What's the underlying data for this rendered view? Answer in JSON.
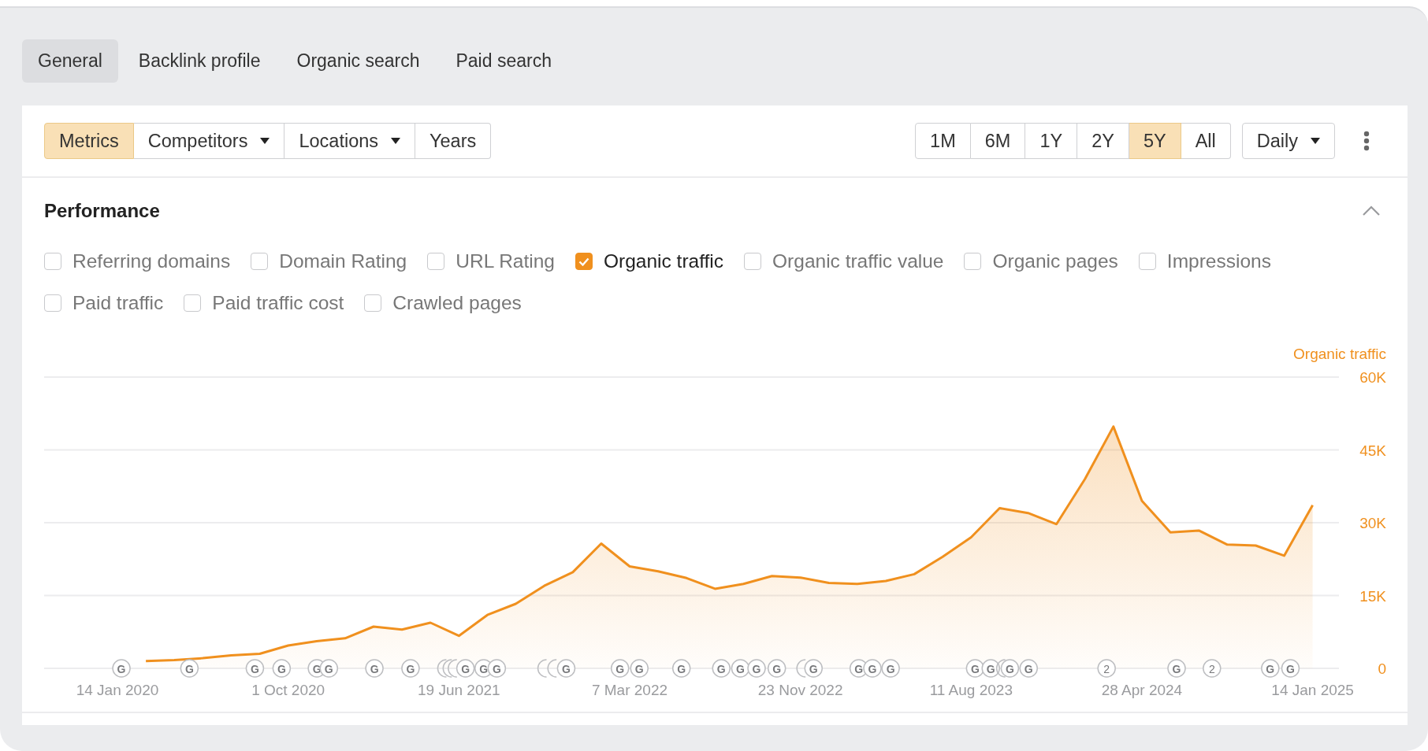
{
  "tabs": [
    {
      "label": "General",
      "selected": true
    },
    {
      "label": "Backlink profile",
      "selected": false
    },
    {
      "label": "Organic search",
      "selected": false
    },
    {
      "label": "Paid search",
      "selected": false
    }
  ],
  "toolbar": {
    "filters": [
      {
        "label": "Metrics",
        "selected": true,
        "kind": "toggle"
      },
      {
        "label": "Competitors",
        "selected": false,
        "kind": "dropdown"
      },
      {
        "label": "Locations",
        "selected": false,
        "kind": "dropdown"
      },
      {
        "label": "Years",
        "selected": false,
        "kind": "toggle"
      }
    ],
    "ranges": [
      {
        "label": "1M",
        "selected": false
      },
      {
        "label": "6M",
        "selected": false
      },
      {
        "label": "1Y",
        "selected": false
      },
      {
        "label": "2Y",
        "selected": false
      },
      {
        "label": "5Y",
        "selected": true
      },
      {
        "label": "All",
        "selected": false
      }
    ],
    "interval": {
      "label": "Daily"
    }
  },
  "performance": {
    "title": "Performance",
    "expanded": true,
    "metric_rows": [
      [
        {
          "label": "Referring domains",
          "checked": false
        },
        {
          "label": "Domain Rating",
          "checked": false
        },
        {
          "label": "URL Rating",
          "checked": false
        },
        {
          "label": "Organic traffic",
          "checked": true
        },
        {
          "label": "Organic traffic value",
          "checked": false
        },
        {
          "label": "Organic pages",
          "checked": false
        },
        {
          "label": "Impressions",
          "checked": false
        }
      ],
      [
        {
          "label": "Paid traffic",
          "checked": false
        },
        {
          "label": "Paid traffic cost",
          "checked": false
        },
        {
          "label": "Crawled pages",
          "checked": false
        }
      ]
    ],
    "chart_data": {
      "type": "area",
      "categories": [
        "14 Jan 2020",
        null,
        null,
        null,
        null,
        null,
        "1 Oct 2020",
        null,
        null,
        null,
        null,
        null,
        "19 Jun 2021",
        null,
        null,
        null,
        null,
        null,
        "7 Mar 2022",
        null,
        null,
        null,
        null,
        null,
        "23 Nov 2022",
        null,
        null,
        null,
        null,
        null,
        "11 Aug 2023",
        null,
        null,
        null,
        null,
        null,
        "28 Apr 2024",
        null,
        null,
        null,
        null,
        null,
        "14 Jan 2025"
      ],
      "series": [
        {
          "name": "Organic traffic",
          "color": "#f0901e",
          "values": [
            null,
            1500,
            1700,
            2100,
            2700,
            3000,
            4700,
            5600,
            6200,
            8600,
            8000,
            9400,
            6700,
            11000,
            13300,
            17000,
            19800,
            25700,
            21000,
            20000,
            18600,
            16400,
            17400,
            19000,
            18700,
            17600,
            17400,
            18000,
            19400,
            23000,
            27000,
            33000,
            32000,
            29700,
            39000,
            49800,
            34500,
            28000,
            28400,
            25500,
            25300,
            23200,
            33600
          ]
        }
      ],
      "ylim": [
        0,
        60000
      ],
      "grid": true,
      "yticks": [
        {
          "value": 0,
          "label": "0"
        },
        {
          "value": 15000,
          "label": "15K"
        },
        {
          "value": 30000,
          "label": "30K"
        },
        {
          "value": 45000,
          "label": "45K"
        },
        {
          "value": 60000,
          "label": "60K"
        }
      ]
    },
    "event_markers": [
      {
        "kind": "google",
        "text": "G"
      },
      {
        "kind": "google",
        "text": "G"
      },
      {
        "kind": "google",
        "text": "G"
      },
      {
        "kind": "google",
        "text": "G"
      },
      {
        "kind": "google",
        "text": "G"
      },
      {
        "kind": "google",
        "text": "G"
      },
      {
        "kind": "google",
        "text": "G"
      },
      {
        "kind": "google",
        "text": "G"
      },
      {
        "kind": "covered"
      },
      {
        "kind": "covered"
      },
      {
        "kind": "covered"
      },
      {
        "kind": "google",
        "text": "G"
      },
      {
        "kind": "google",
        "text": "G"
      },
      {
        "kind": "google",
        "text": "G"
      },
      {
        "kind": "covered"
      },
      {
        "kind": "covered"
      },
      {
        "kind": "google",
        "text": "G"
      },
      {
        "kind": "google",
        "text": "G"
      },
      {
        "kind": "google",
        "text": "G"
      },
      {
        "kind": "google",
        "text": "G"
      },
      {
        "kind": "google",
        "text": "G"
      },
      {
        "kind": "google",
        "text": "G"
      },
      {
        "kind": "google",
        "text": "G"
      },
      {
        "kind": "google",
        "text": "G"
      },
      {
        "kind": "covered"
      },
      {
        "kind": "google",
        "text": "G"
      },
      {
        "kind": "google",
        "text": "G"
      },
      {
        "kind": "google",
        "text": "G"
      },
      {
        "kind": "google",
        "text": "G"
      },
      {
        "kind": "google",
        "text": "G"
      },
      {
        "kind": "google",
        "text": "G"
      },
      {
        "kind": "covered"
      },
      {
        "kind": "google",
        "text": "G"
      },
      {
        "kind": "google",
        "text": "G"
      },
      {
        "kind": "count",
        "text": "2"
      },
      {
        "kind": "google",
        "text": "G"
      },
      {
        "kind": "count",
        "text": "2"
      },
      {
        "kind": "google",
        "text": "G"
      },
      {
        "kind": "google",
        "text": "G"
      }
    ]
  }
}
